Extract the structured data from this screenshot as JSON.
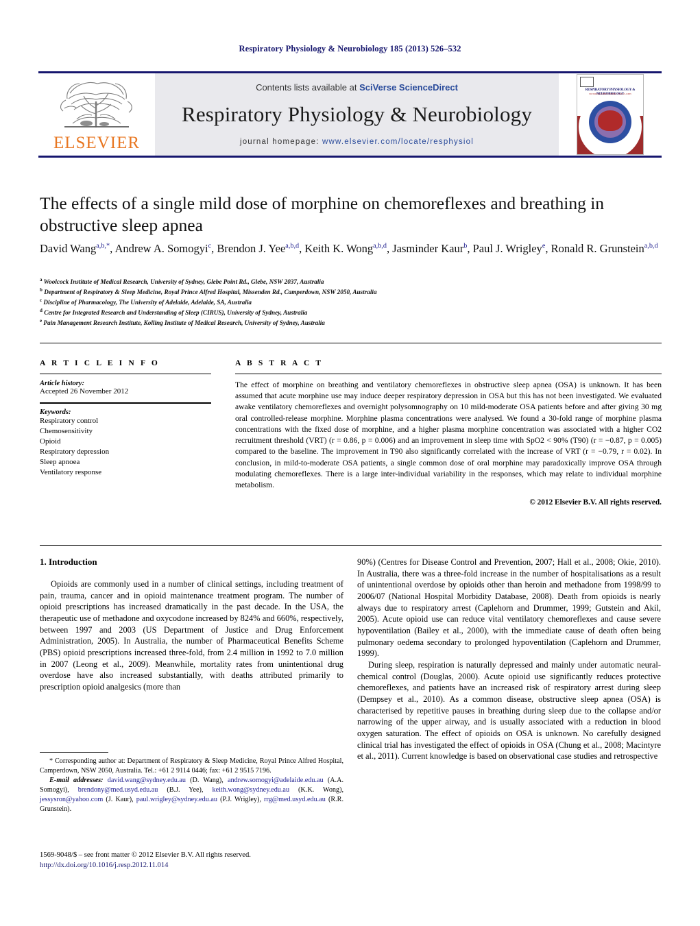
{
  "journal_ref": "Respiratory Physiology & Neurobiology 185 (2013) 526–532",
  "masthead": {
    "contents_prefix": "Contents lists available at ",
    "contents_link": "SciVerse ScienceDirect",
    "journal_title": "Respiratory Physiology & Neurobiology",
    "homepage_prefix": "journal homepage: ",
    "homepage_link": "www.elsevier.com/locate/resphysiol",
    "publisher_logo_text": "ELSEVIER",
    "cover_title": "RESPIRATORY PHYSIOLOGY & NEUROBIOLOGY",
    "cover_subtitle": "EDITORS-IN-CHIEF   P. SCHEID · W.M. ST.-JOHN"
  },
  "article": {
    "title": "The effects of a single mild dose of morphine on chemoreflexes and breathing in obstructive sleep apnea",
    "authors_line1": "David Wang",
    "authors": [
      {
        "name": "David Wang",
        "marks": "a,b,*"
      },
      {
        "name": "Andrew A. Somogyi",
        "marks": "c"
      },
      {
        "name": "Brendon J. Yee",
        "marks": "a,b,d"
      },
      {
        "name": "Keith K. Wong",
        "marks": "a,b,d"
      },
      {
        "name": "Jasminder Kaur",
        "marks": "b"
      },
      {
        "name": "Paul J. Wrigley",
        "marks": "e"
      },
      {
        "name": "Ronald R. Grunstein",
        "marks": "a,b,d"
      }
    ],
    "affiliations": [
      {
        "mark": "a",
        "text": "Woolcock Institute of Medical Research, University of Sydney, Glebe Point Rd., Glebe, NSW 2037, Australia"
      },
      {
        "mark": "b",
        "text": "Department of Respiratory & Sleep Medicine, Royal Prince Alfred Hospital, Missenden Rd., Camperdown, NSW 2050, Australia"
      },
      {
        "mark": "c",
        "text": "Discipline of Pharmacology, The University of Adelaide, Adelaide, SA, Australia"
      },
      {
        "mark": "d",
        "text": "Centre for Integrated Research and Understanding of Sleep (CIRUS), University of Sydney, Australia"
      },
      {
        "mark": "e",
        "text": "Pain Management Research Institute, Kolling Institute of Medical Research, University of Sydney, Australia"
      }
    ]
  },
  "article_info": {
    "heading": "A R T I C L E    I N F O",
    "history_label": "Article history:",
    "history_value": "Accepted 26 November 2012",
    "keywords_label": "Keywords:",
    "keywords": [
      "Respiratory control",
      "Chemosensitivity",
      "Opioid",
      "Respiratory depression",
      "Sleep apnoea",
      "Ventilatory response"
    ]
  },
  "abstract": {
    "heading": "A B S T R A C T",
    "body": "The effect of morphine on breathing and ventilatory chemoreflexes in obstructive sleep apnea (OSA) is unknown. It has been assumed that acute morphine use may induce deeper respiratory depression in OSA but this has not been investigated. We evaluated awake ventilatory chemoreflexes and overnight polysomnography on 10 mild-moderate OSA patients before and after giving 30 mg oral controlled-release morphine. Morphine plasma concentrations were analysed. We found a 30-fold range of morphine plasma concentrations with the fixed dose of morphine, and a higher plasma morphine concentration was associated with a higher CO2 recruitment threshold (VRT) (r = 0.86, p = 0.006) and an improvement in sleep time with SpO2 < 90% (T90) (r = −0.87, p = 0.005) compared to the baseline. The improvement in T90 also significantly correlated with the increase of VRT (r = −0.79, r = 0.02). In conclusion, in mild-to-moderate OSA patients, a single common dose of oral morphine may paradoxically improve OSA through modulating chemoreflexes. There is a large inter-individual variability in the responses, which may relate to individual morphine metabolism.",
    "copyright": "© 2012 Elsevier B.V. All rights reserved."
  },
  "body": {
    "section_heading": "1.  Introduction",
    "left_paragraph_1": "Opioids are commonly used in a number of clinical settings, including treatment of pain, trauma, cancer and in opioid maintenance treatment program. The number of opioid prescriptions has increased dramatically in the past decade. In the USA, the therapeutic use of methadone and oxycodone increased by 824% and 660%, respectively, between 1997 and 2003 (US Department of Justice and Drug Enforcement Administration, 2005). In Australia, the number of Pharmaceutical Benefits Scheme (PBS) opioid prescriptions increased three-fold, from 2.4 million in 1992 to 7.0 million in 2007 (Leong et al., 2009). Meanwhile, mortality rates from unintentional drug overdose have also increased substantially, with deaths attributed primarily to prescription opioid analgesics (more than",
    "right_paragraph_1": "90%) (Centres for Disease Control and Prevention, 2007; Hall et al., 2008; Okie, 2010). In Australia, there was a three-fold increase in the number of hospitalisations as a result of unintentional overdose by opioids other than heroin and methadone from 1998/99 to 2006/07 (National Hospital Morbidity Database, 2008). Death from opioids is nearly always due to respiratory arrest (Caplehorn and Drummer, 1999; Gutstein and Akil, 2005). Acute opioid use can reduce vital ventilatory chemoreflexes and cause severe hypoventilation (Bailey et al., 2000), with the immediate cause of death often being pulmonary oedema secondary to prolonged hypoventilation (Caplehorn and Drummer, 1999).",
    "right_paragraph_2": "During sleep, respiration is naturally depressed and mainly under automatic neural-chemical control (Douglas, 2000). Acute opioid use significantly reduces protective chemoreflexes, and patients have an increased risk of respiratory arrest during sleep (Dempsey et al., 2010). As a common disease, obstructive sleep apnea (OSA) is characterised by repetitive pauses in breathing during sleep due to the collapse and/or narrowing of the upper airway, and is usually associated with a reduction in blood oxygen saturation. The effect of opioids on OSA is unknown. No carefully designed clinical trial has investigated the effect of opioids in OSA (Chung et al., 2008; Macintyre et al., 2011). Current knowledge is based on observational case studies and retrospective"
  },
  "footnote": {
    "corresponding": "* Corresponding author at: Department of Respiratory & Sleep Medicine, Royal Prince Alfred Hospital, Camperdown, NSW 2050, Australia. Tel.: +61 2 9114 0446; fax: +61 2 9515 7196.",
    "email_label": "E-mail addresses:",
    "emails": [
      {
        "address": "david.wang@sydney.edu.au",
        "owner": "(D. Wang),"
      },
      {
        "address": "andrew.somogyi@adelaide.edu.au",
        "owner": "(A.A. Somogyi),"
      },
      {
        "address": "brendony@med.usyd.edu.au",
        "owner": "(B.J. Yee),"
      },
      {
        "address": "keith.wong@sydney.edu.au",
        "owner": "(K.K. Wong),"
      },
      {
        "address": "jessysron@yahoo.com",
        "owner": "(J. Kaur),"
      },
      {
        "address": "paul.wrigley@sydney.edu.au",
        "owner": "(P.J. Wrigley),"
      },
      {
        "address": "rrg@med.usyd.edu.au",
        "owner": "(R.R. Grunstein)."
      }
    ]
  },
  "colophon": {
    "issn_line": "1569-9048/$ – see front matter © 2012 Elsevier B.V. All rights reserved.",
    "doi_line": "http://dx.doi.org/10.1016/j.resp.2012.11.014"
  }
}
